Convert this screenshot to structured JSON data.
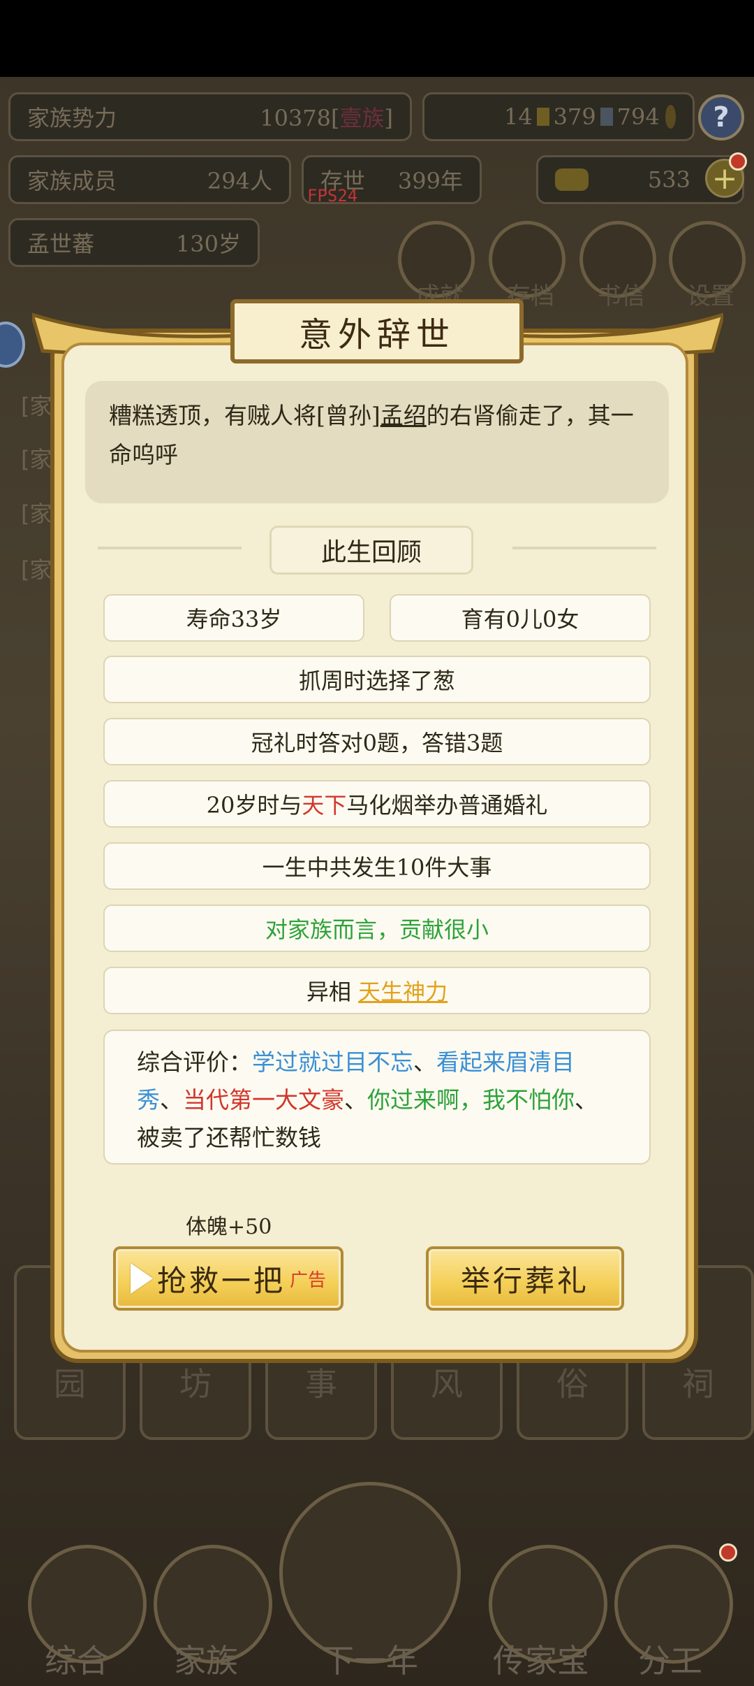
{
  "background": {
    "family_power_label": "家族势力",
    "family_power_value": "10378[",
    "family_power_rank": "壹族",
    "family_power_close": "]",
    "res1": "14",
    "res2": "379",
    "res3": "794",
    "members_label": "家族成员",
    "members_value": "294人",
    "existence_label": "存世",
    "existence_value": "399年",
    "gold_value": "533",
    "fps": "FPS24",
    "elder_label": "孟世蕃",
    "elder_value": "130岁",
    "top_buttons": [
      "成就",
      "存档",
      "书信",
      "设置"
    ],
    "mid_buttons": [
      "园",
      "坊",
      "事",
      "风",
      "俗",
      "祠"
    ],
    "bottom_nav": [
      "综合",
      "家族",
      "下一年",
      "传家宝",
      "分工"
    ]
  },
  "dialog": {
    "title": "意外辞世",
    "message_before": "糟糕透顶，有贼人将[曾孙]",
    "message_name": "孟绍",
    "message_after": "的右肾偷走了，其一命呜呼",
    "review_title": "此生回顾",
    "lifespan": "寿命33岁",
    "children": "育有0儿0女",
    "grab_ceremony": "抓周时选择了葱",
    "capping": "冠礼时答对0题，答错3题",
    "marriage_before": "20岁时与",
    "marriage_place": "天下",
    "marriage_after": "马化烟举办普通婚礼",
    "events": "一生中共发生10件大事",
    "contribution": "对家族而言，贡献很小",
    "trait_prefix": "异相",
    "trait": "天生神力",
    "summary_label": "综合评价：",
    "summary_t1": "学过就过目不忘",
    "summary_t2": "看起来眉清目秀",
    "summary_t3": "当代第一大文豪",
    "summary_t4": "你过来啊，我不怕你",
    "summary_t5": "被卖了还帮忙数钱",
    "sep": "、",
    "bonus": "体魄+50",
    "rescue_label": "抢救一把",
    "ad_label": "广告",
    "funeral_label": "举行葬礼"
  }
}
